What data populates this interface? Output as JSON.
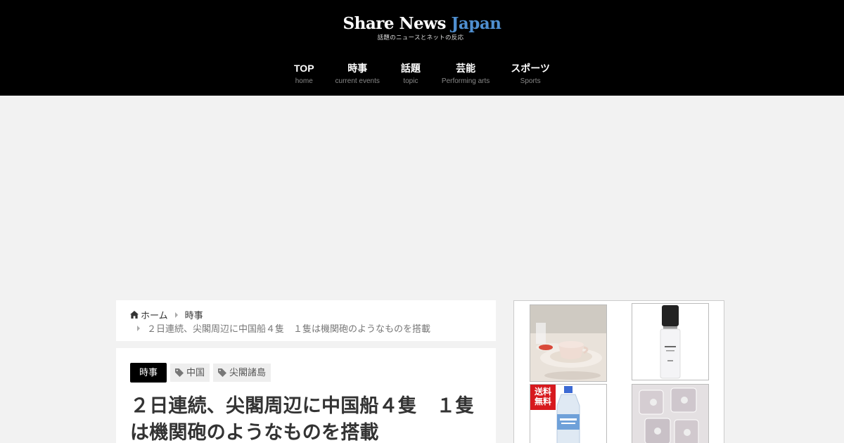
{
  "site": {
    "title_main": "Share News",
    "title_accent": "Japan",
    "tagline": "話題のニュースとネットの反応"
  },
  "nav": [
    {
      "label": "TOP",
      "sub": "home"
    },
    {
      "label": "時事",
      "sub": "current events"
    },
    {
      "label": "話題",
      "sub": "topic"
    },
    {
      "label": "芸能",
      "sub": "Performing arts"
    },
    {
      "label": "スポーツ",
      "sub": "Sports"
    }
  ],
  "breadcrumb": {
    "home": "ホーム",
    "category": "時事",
    "current": "２日連続、尖閣周辺に中国船４隻　１隻は機関砲のようなものを搭載"
  },
  "article": {
    "category": "時事",
    "tags": [
      "中国",
      "尖閣諸島"
    ],
    "title": "２日連続、尖閣周辺に中国船４隻　１隻は機関砲のようなものを搭載"
  },
  "sidebar": {
    "badge_line1": "送料",
    "badge_line2": "無料"
  },
  "colors": {
    "header_bg": "#000000",
    "logo_accent": "#4f8fd0",
    "page_bg": "#f2f2f2"
  }
}
